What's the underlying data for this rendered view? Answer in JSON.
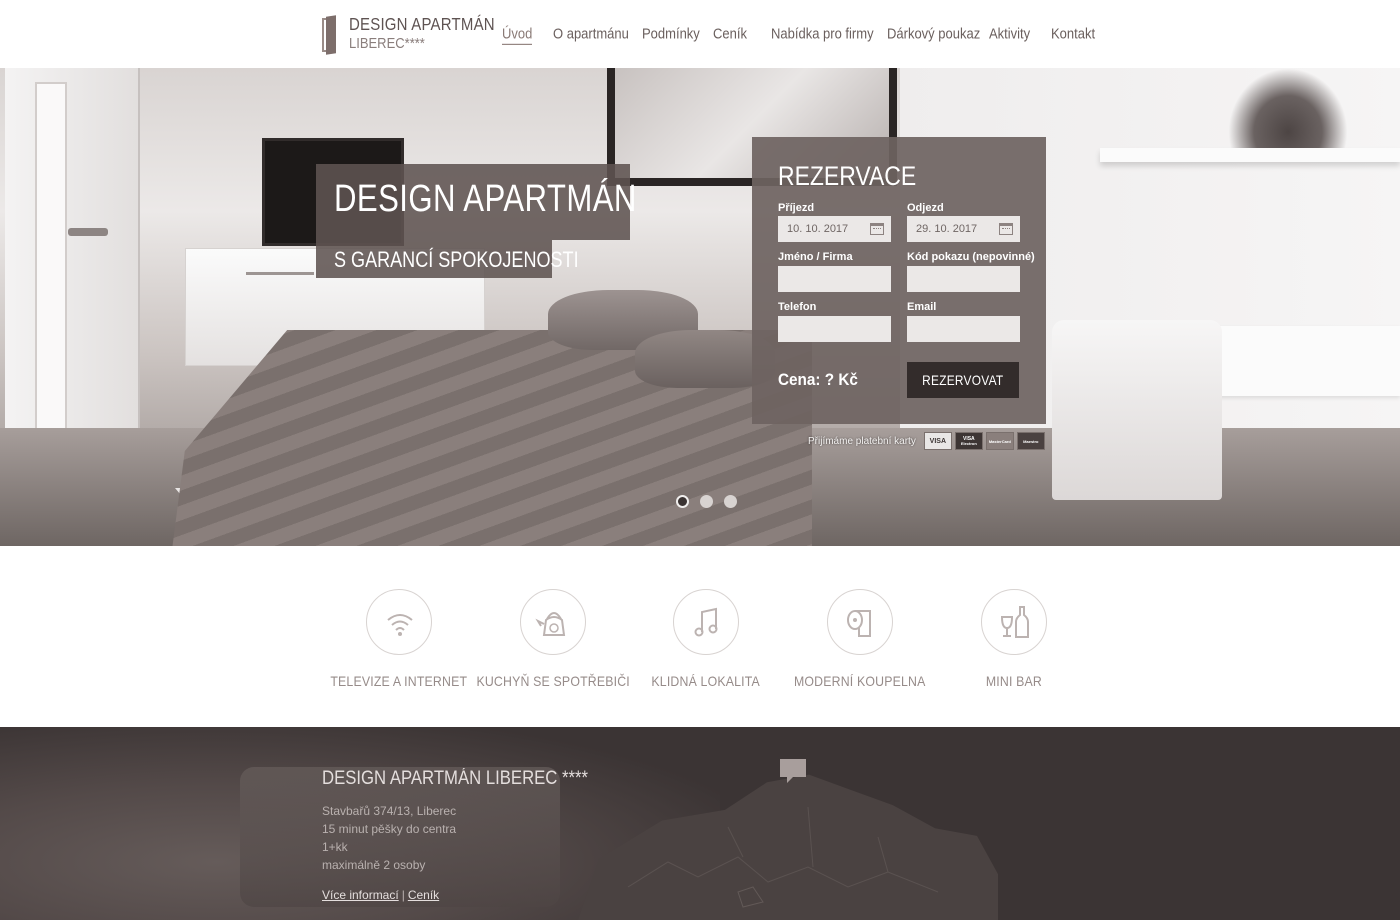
{
  "header": {
    "logo_title": "DESIGN APARTMÁN",
    "logo_sub": "LIBEREC****",
    "nav": [
      {
        "label": "Úvod",
        "active": true
      },
      {
        "label": "O apartmánu",
        "active": false
      },
      {
        "label": "Podmínky",
        "active": false
      },
      {
        "label": "Ceník",
        "active": false
      },
      {
        "label": "Nabídka pro firmy",
        "active": false
      },
      {
        "label": "Dárkový poukaz",
        "active": false
      },
      {
        "label": "Aktivity",
        "active": false
      },
      {
        "label": "Kontakt",
        "active": false
      }
    ]
  },
  "hero": {
    "title": "DESIGN APARTMÁN",
    "subtitle": "S GARANCÍ SPOKOJENOSTI",
    "slides_total": 3,
    "slide_active": 1
  },
  "reservation": {
    "title": "REZERVACE",
    "arrival_label": "Příjezd",
    "arrival_value": "10. 10. 2017",
    "departure_label": "Odjezd",
    "departure_value": "29. 10. 2017",
    "name_label": "Jméno / Firma",
    "name_value": "",
    "voucher_label": "Kód pokazu (nepovinné)",
    "voucher_value": "",
    "phone_label": "Telefon",
    "phone_value": "",
    "email_label": "Email",
    "email_value": "",
    "price_text": "Cena: ? Kč",
    "submit_label": "REZERVOVAT"
  },
  "payments": {
    "label": "Přijímáme platební karty",
    "cards": [
      "VISA",
      "VISA Electron",
      "MasterCard",
      "Maestro"
    ]
  },
  "features": [
    {
      "label": "TELEVIZE A INTERNET",
      "icon": "wifi-icon"
    },
    {
      "label": "KUCHYŇ SE SPOTŘEBIČI",
      "icon": "kettle-icon"
    },
    {
      "label": "KLIDNÁ LOKALITA",
      "icon": "music-note-icon"
    },
    {
      "label": "MODERNÍ KOUPELNA",
      "icon": "toilet-paper-icon"
    },
    {
      "label": "MINI BAR",
      "icon": "wine-bottle-icon"
    }
  ],
  "footer": {
    "title": "DESIGN APARTMÁN LIBEREC ****",
    "address": "Stavbařů 374/13, Liberec",
    "distance": "15 minut pěšky do centra",
    "layout": "1+kk",
    "capacity": "maximálně 2 osoby",
    "link_more": "Více informací",
    "link_separator": "|",
    "link_prices": "Ceník"
  },
  "colors": {
    "accent_dark": "#332c2b",
    "panel": "#6e6361",
    "footer_bg": "#3b3434",
    "feature_text": "#968b89"
  }
}
